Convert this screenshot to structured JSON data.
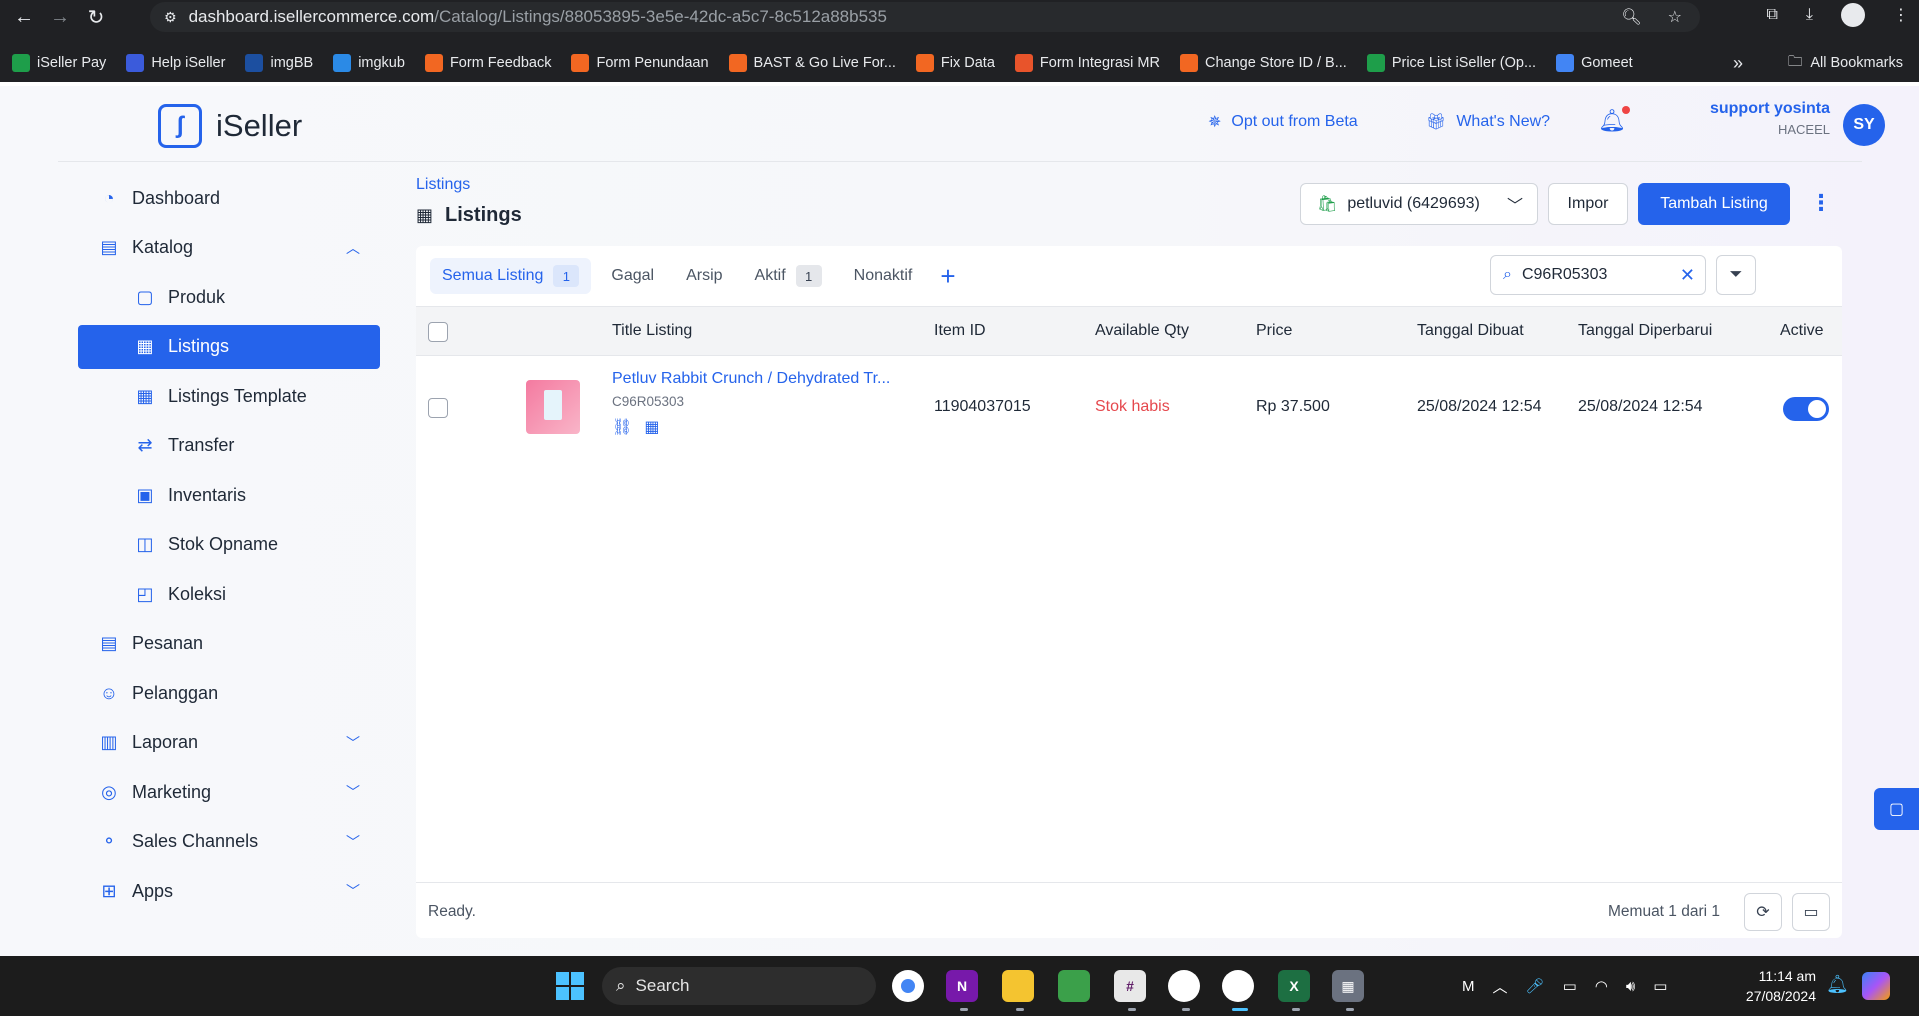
{
  "browser": {
    "url_main": "dashboard.isellercommerce.com",
    "url_path": "/Catalog/Listings/88053895-3e5e-42dc-a5c7-8c512a88b535",
    "bookmarks": [
      "iSeller Pay",
      "Help iSeller",
      "imgBB",
      "imgkub",
      "Form Feedback",
      "Form Penundaan",
      "BAST & Go Live For...",
      "Fix Data",
      "Form Integrasi MR",
      "Change Store ID / B...",
      "Price List iSeller (Op...",
      "Gomeet"
    ],
    "bookmark_colors": [
      "#1e9e4a",
      "#3b5bdb",
      "#1c4fa0",
      "#2b8ae6",
      "#f26722",
      "#f26722",
      "#f26722",
      "#f26722",
      "#e8542b",
      "#f26722",
      "#1e9e4a",
      "#4285f4"
    ],
    "all_bookmarks": "All Bookmarks"
  },
  "header": {
    "logo_text": "iSeller",
    "opt_out": "Opt out from Beta",
    "whats_new": "What's New?",
    "user_name": "support yosinta",
    "user_company": "HACEEL",
    "avatar_initials": "SY"
  },
  "sidebar": {
    "items": [
      {
        "label": "Dashboard",
        "icon": "dashboard-icon"
      },
      {
        "label": "Katalog",
        "icon": "catalog-icon"
      },
      {
        "label": "Produk",
        "icon": "product-icon"
      },
      {
        "label": "Listings",
        "icon": "listings-icon"
      },
      {
        "label": "Listings Template",
        "icon": "listings-template-icon"
      },
      {
        "label": "Transfer",
        "icon": "transfer-icon"
      },
      {
        "label": "Inventaris",
        "icon": "inventory-icon"
      },
      {
        "label": "Stok Opname",
        "icon": "stock-opname-icon"
      },
      {
        "label": "Koleksi",
        "icon": "collection-icon"
      },
      {
        "label": "Pesanan",
        "icon": "orders-icon"
      },
      {
        "label": "Pelanggan",
        "icon": "customers-icon"
      },
      {
        "label": "Laporan",
        "icon": "reports-icon"
      },
      {
        "label": "Marketing",
        "icon": "marketing-icon"
      },
      {
        "label": "Sales Channels",
        "icon": "sales-channels-icon"
      },
      {
        "label": "Apps",
        "icon": "apps-icon"
      }
    ]
  },
  "main": {
    "breadcrumb": "Listings",
    "title": "Listings",
    "store_selector": "petluvid (6429693)",
    "import_label": "Impor",
    "add_listing_label": "Tambah Listing",
    "tabs": [
      {
        "label": "Semua Listing",
        "count": "1"
      },
      {
        "label": "Gagal",
        "count": null
      },
      {
        "label": "Arsip",
        "count": null
      },
      {
        "label": "Aktif",
        "count": "1"
      },
      {
        "label": "Nonaktif",
        "count": null
      }
    ],
    "search_value": "C96R05303",
    "columns": [
      "Title Listing",
      "Item ID",
      "Available Qty",
      "Price",
      "Tanggal Dibuat",
      "Tanggal Diperbarui",
      "Active"
    ],
    "rows": [
      {
        "title": "Petluv Rabbit Crunch / Dehydrated Tr...",
        "sku": "C96R05303",
        "item_id": "11904037015",
        "available_qty": "Stok habis",
        "price": "Rp 37.500",
        "created": "25/08/2024 12:54",
        "updated": "25/08/2024 12:54",
        "active": true
      }
    ],
    "status": "Ready.",
    "paging": "Memuat 1 dari 1"
  },
  "taskbar": {
    "search_label": "Search",
    "time": "11:14 am",
    "date": "27/08/2024"
  },
  "colors": {
    "primary": "#2563eb",
    "danger": "#e5484d"
  }
}
